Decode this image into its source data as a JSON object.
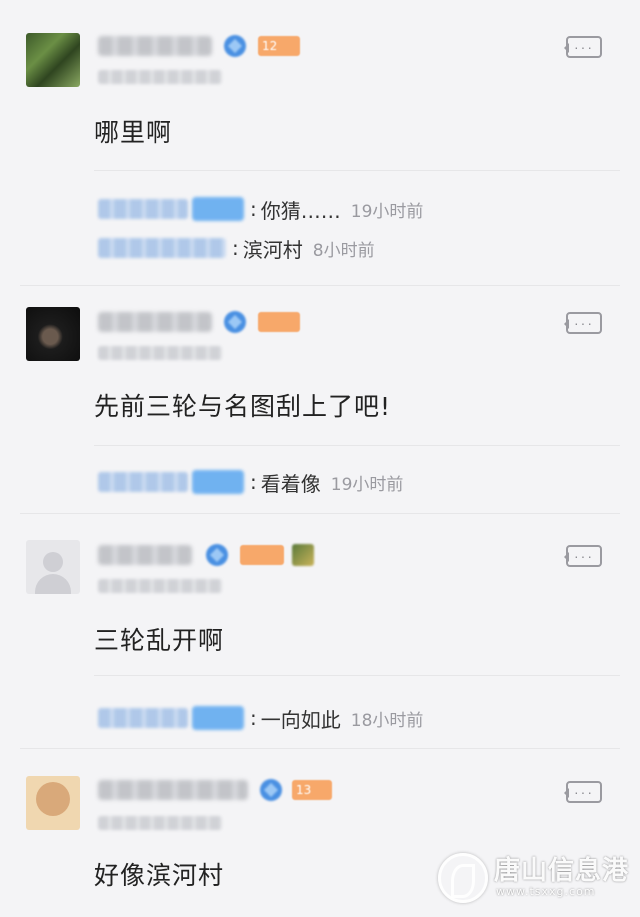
{
  "comments": [
    {
      "text": "哪里啊",
      "level": "12",
      "replies": [
        {
          "text": "你猜……",
          "time": "19小时前"
        },
        {
          "text": "滨河村",
          "time": "8小时前"
        }
      ]
    },
    {
      "text": "先前三轮与名图刮上了吧!",
      "level": "",
      "replies": [
        {
          "text": "看着像",
          "time": "19小时前"
        }
      ]
    },
    {
      "text": "三轮乱开啊",
      "level": "",
      "replies": [
        {
          "text": "一向如此",
          "time": "18小时前"
        }
      ]
    },
    {
      "text": "好像滨河村",
      "level": "13",
      "replies": []
    }
  ],
  "more_button": {
    "icon": "comment-more-icon",
    "label": "···"
  },
  "watermark": {
    "title": "唐山信息港",
    "url": "www.tsxxg.com"
  },
  "colors": {
    "background": "#f4f4f6",
    "level_badge": "#f7a86a",
    "role_badge": "#5aa7f0",
    "time_text": "#9a9aa0"
  }
}
